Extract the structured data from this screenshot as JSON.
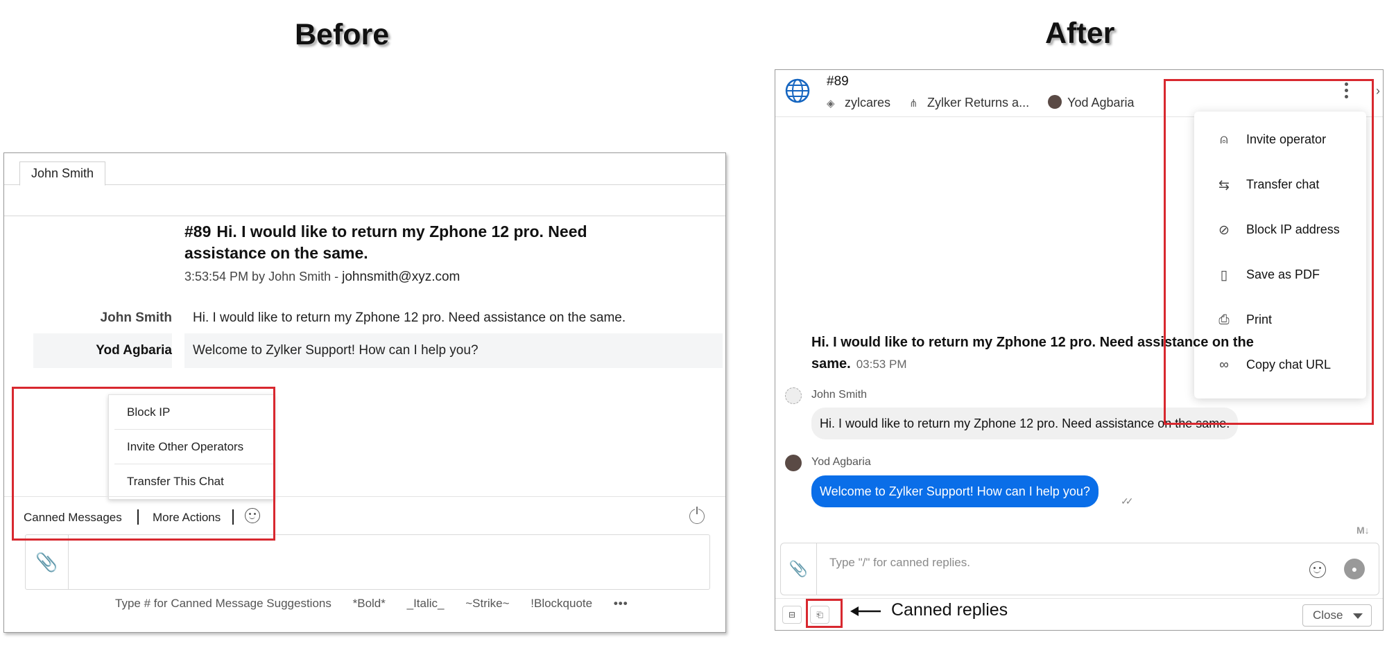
{
  "headings": {
    "before": "Before",
    "after": "After"
  },
  "before": {
    "tab": "John Smith",
    "chat_number": "#89",
    "chat_title": "Hi. I would like to return my Zphone 12 pro. Need assistance on the same.",
    "meta_prefix": "3:53:54 PM by John Smith - ",
    "meta_email": "johnsmith@xyz.com",
    "messages": [
      {
        "sender": "John Smith",
        "text": "Hi. I would like to return my Zphone 12 pro. Need assistance on the same."
      },
      {
        "sender": "Yod Agbaria",
        "text": "Welcome to Zylker Support! How can I help you?"
      }
    ],
    "menu": [
      "Block IP",
      "Invite Other Operators",
      "Transfer This Chat"
    ],
    "actions": {
      "canned": "Canned Messages",
      "more": "More Actions"
    },
    "hints": [
      "Type # for Canned Message Suggestions",
      "*Bold*",
      "_Italic_",
      "~Strike~",
      "!Blockquote",
      "•••"
    ]
  },
  "after": {
    "chat_id": "#89",
    "crumbs": {
      "portal": "zylcares",
      "department": "Zylker Returns a...",
      "operator": "Yod Agbaria"
    },
    "menu": [
      {
        "icon": "invite-operator-icon",
        "label": "Invite operator"
      },
      {
        "icon": "transfer-icon",
        "label": "Transfer chat"
      },
      {
        "icon": "block-icon",
        "label": "Block IP address"
      },
      {
        "icon": "pdf-icon",
        "label": "Save as PDF"
      },
      {
        "icon": "print-icon",
        "label": "Print"
      },
      {
        "icon": "link-icon",
        "label": "Copy chat URL"
      }
    ],
    "question": "Hi. I would like to return my Zphone 12 pro. Need assistance on the same.",
    "question_time": "03:53 PM",
    "messages": [
      {
        "sender": "John Smith",
        "text": "Hi. I would like to return my Zphone 12 pro. Need assistance on the same."
      },
      {
        "sender": "Yod Agbaria",
        "text": "Welcome to Zylker Support! How can I help you?"
      }
    ],
    "markdown_badge": "M↓",
    "compose_placeholder": "Type \"/\" for canned replies.",
    "close_label": "Close",
    "annotation": "Canned replies"
  },
  "colors": {
    "highlight_box": "#d8282f",
    "operator_bubble": "#0a6ee8"
  }
}
